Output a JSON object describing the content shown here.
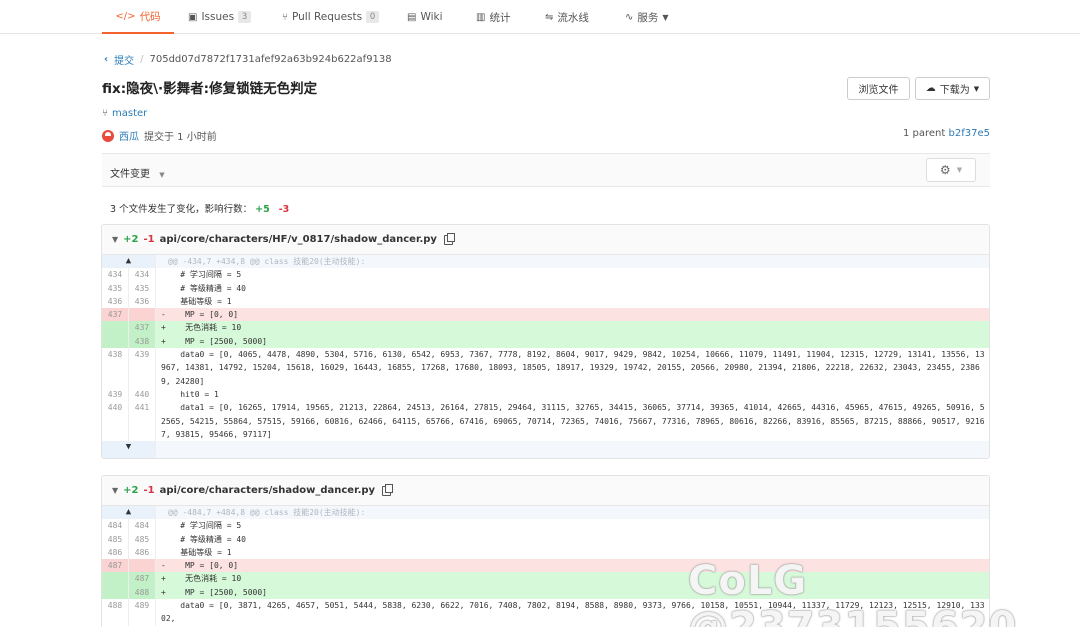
{
  "nav": {
    "tabs": [
      {
        "label": "代码",
        "icon": "code-icon"
      },
      {
        "label": "Issues",
        "icon": "issues-icon",
        "count": "3"
      },
      {
        "label": "Pull Requests",
        "icon": "pull-request-icon",
        "count": "0"
      },
      {
        "label": "Wiki",
        "icon": "wiki-icon"
      },
      {
        "label": "统计",
        "icon": "chart-icon"
      },
      {
        "label": "流水线",
        "icon": "pipeline-icon"
      },
      {
        "label": "服务",
        "icon": "service-icon"
      }
    ]
  },
  "breadcrumb": {
    "back": "提交",
    "sha": "705dd07d7872f1731afef92a63b924b622af9138"
  },
  "commit": {
    "title": "fix:隐夜\\·影舞者:修复锁链无色判定",
    "branch": "master",
    "author": "西瓜",
    "time": "提交于 1 小时前",
    "parent_label": "1 parent",
    "parent_sha": "b2f37e5"
  },
  "buttons": {
    "browse": "浏览文件",
    "download": "下载为"
  },
  "changes": {
    "label": "文件变更",
    "summary": "3 个文件发生了变化，影响行数：",
    "plus": "+5",
    "minus": "-3"
  },
  "files": [
    {
      "plus": "+2",
      "minus": "-1",
      "path": "api/core/characters/HF/v_0817/shadow_dancer.py",
      "hunk": "@@ -434,7 +434,8 @@ class 技能20(主动技能):",
      "lines": [
        {
          "t": "ctx",
          "o": "434",
          "n": "434",
          "code": "    # 学习间隔 = 5"
        },
        {
          "t": "ctx",
          "o": "435",
          "n": "435",
          "code": "    # 等级精通 = 40"
        },
        {
          "t": "ctx",
          "o": "436",
          "n": "436",
          "code": "    基础等级 = 1"
        },
        {
          "t": "del",
          "o": "437",
          "n": "",
          "code": "-    MP = [0, 0]"
        },
        {
          "t": "add",
          "o": "",
          "n": "437",
          "code": "+    无色消耗 = 10"
        },
        {
          "t": "add",
          "o": "",
          "n": "438",
          "code": "+    MP = [2500, 5000]"
        },
        {
          "t": "ctx",
          "o": "438",
          "n": "439",
          "code": "    data0 = [0, 4065, 4478, 4890, 5304, 5716, 6130, 6542, 6953, 7367, 7778, 8192, 8604, 9017, 9429, 9842, 10254, 10666, 11079, 11491, 11904, 12315, 12729, 13141, 13556, 13967, 14381, 14792, 15204, 15618, 16029, 16443, 16855, 17268, 17680, 18093, 18505, 18917, 19329, 19742, 20155, 20566, 20980, 21394, 21806, 22218, 22632, 23043, 23455, 23869, 24280]"
        },
        {
          "t": "ctx",
          "o": "439",
          "n": "440",
          "code": "    hit0 = 1"
        },
        {
          "t": "ctx",
          "o": "440",
          "n": "441",
          "code": "    data1 = [0, 16265, 17914, 19565, 21213, 22864, 24513, 26164, 27815, 29464, 31115, 32765, 34415, 36065, 37714, 39365, 41014, 42665, 44316, 45965, 47615, 49265, 50916, 52565, 54215, 55864, 57515, 59166, 60816, 62466, 64115, 65766, 67416, 69065, 70714, 72365, 74016, 75667, 77316, 78965, 80616, 82266, 83916, 85565, 87215, 88866, 90517, 92167, 93815, 95466, 97117]"
        }
      ]
    },
    {
      "plus": "+2",
      "minus": "-1",
      "path": "api/core/characters/shadow_dancer.py",
      "hunk": "@@ -484,7 +484,8 @@ class 技能20(主动技能):",
      "lines": [
        {
          "t": "ctx",
          "o": "484",
          "n": "484",
          "code": "    # 学习间隔 = 5"
        },
        {
          "t": "ctx",
          "o": "485",
          "n": "485",
          "code": "    # 等级精通 = 40"
        },
        {
          "t": "ctx",
          "o": "486",
          "n": "486",
          "code": "    基础等级 = 1"
        },
        {
          "t": "del",
          "o": "487",
          "n": "",
          "code": "-    MP = [0, 0]"
        },
        {
          "t": "add",
          "o": "",
          "n": "487",
          "code": "+    无色消耗 = 10"
        },
        {
          "t": "add",
          "o": "",
          "n": "488",
          "code": "+    MP = [2500, 5000]"
        },
        {
          "t": "ctx",
          "o": "488",
          "n": "489",
          "code": "    data0 = [0, 3871, 4265, 4657, 5051, 5444, 5838, 6230, 6622, 7016, 7408, 7802, 8194, 8588, 8980, 9373, 9766, 10158, 10551, 10944, 11337, 11729, 12123, 12515, 12910, 13302,"
        }
      ]
    }
  ],
  "watermark": "CoLG @2373155620"
}
